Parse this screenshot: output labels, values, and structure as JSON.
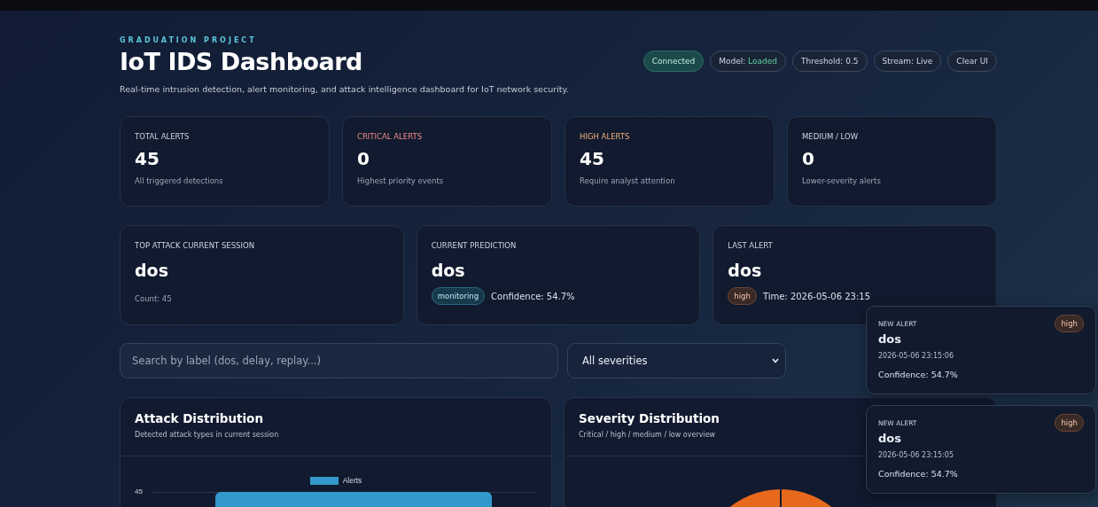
{
  "header": {
    "eyebrow": "GRADUATION PROJECT",
    "title": "IoT IDS Dashboard",
    "subtitle": "Real-time intrusion detection, alert monitoring, and attack intelligence dashboard for IoT network security."
  },
  "status_pills": [
    {
      "kind": "status",
      "label": "Connected"
    },
    {
      "kind": "model",
      "label": "Model: ",
      "value": "Loaded"
    },
    {
      "kind": "info",
      "label": "Threshold: 0.5"
    },
    {
      "kind": "info",
      "label": "Stream: Live"
    },
    {
      "kind": "button",
      "label": "Clear UI"
    }
  ],
  "stats": [
    {
      "label": "TOTAL ALERTS",
      "kind": "plain",
      "value": "45",
      "note": "All triggered detections"
    },
    {
      "label": "CRITICAL ALERTS",
      "kind": "critical",
      "value": "0",
      "note": "Highest priority events"
    },
    {
      "label": "HIGH ALERTS",
      "kind": "high",
      "value": "45",
      "note": "Require analyst attention"
    },
    {
      "label": "MEDIUM / LOW",
      "kind": "plain",
      "value": "0",
      "note": "Lower-severity alerts"
    }
  ],
  "summary": [
    {
      "kind": "count",
      "label": "TOP ATTACK CURRENT SESSION",
      "value": "dos",
      "note": "Count: 45"
    },
    {
      "kind": "prediction",
      "label": "CURRENT PREDICTION",
      "value": "dos",
      "badge": "monitoring",
      "note": "Confidence: 54.7%"
    },
    {
      "kind": "last",
      "label": "LAST ALERT",
      "value": "dos",
      "badge": "high",
      "note": "Time: 2026-05-06 23:15"
    }
  ],
  "filters": {
    "search_placeholder": "Search by label (dos, delay, replay...)",
    "severity_select": "All severities"
  },
  "panels": [
    {
      "kind": "bar",
      "title": "Attack Distribution",
      "subtitle": "Detected attack types in current session",
      "legend": "Alerts",
      "y_tick": "45"
    },
    {
      "kind": "pie",
      "title": "Severity Distribution",
      "subtitle": "Critical / high / medium / low overview"
    }
  ],
  "toasts": [
    {
      "heading": "NEW ALERT",
      "badge": "high",
      "label": "dos",
      "time": "2026-05-06 23:15:06",
      "confidence": "Confidence: 54.7%"
    },
    {
      "heading": "NEW ALERT",
      "badge": "high",
      "label": "dos",
      "time": "2026-05-06 23:15:05",
      "confidence": "Confidence: 54.7%"
    }
  ]
}
